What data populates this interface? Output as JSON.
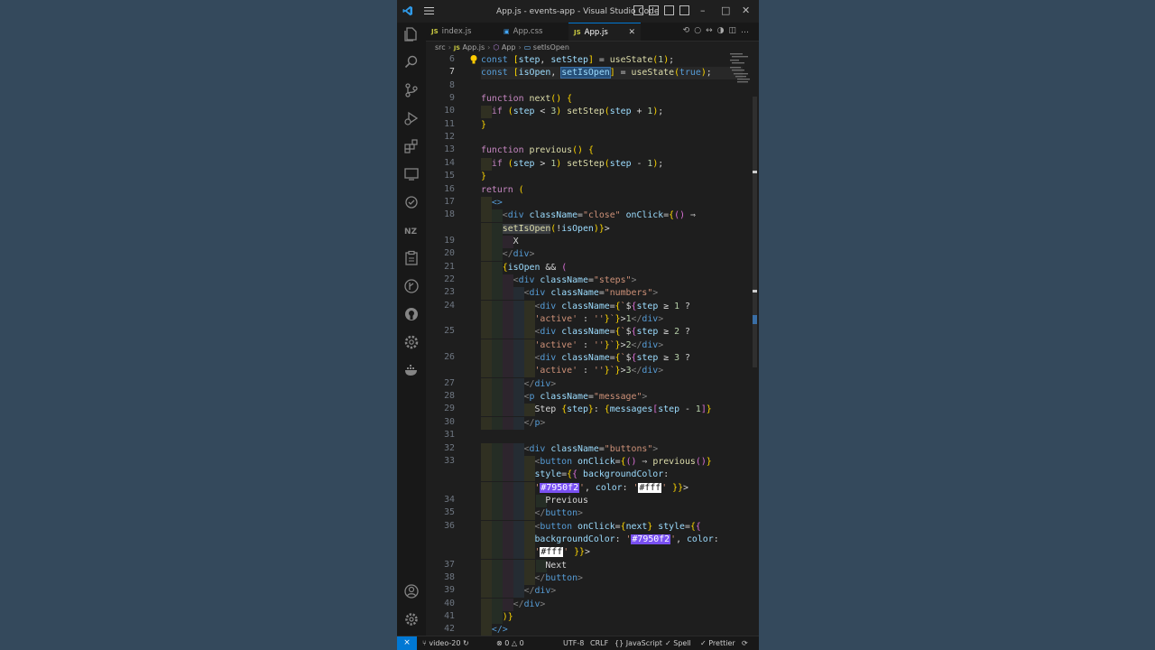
{
  "window": {
    "title": "App.js - events-app - Visual Studio Code",
    "brand_color": "#0078d4"
  },
  "tabs": [
    {
      "icon": "JS",
      "label": "index.js",
      "active": false
    },
    {
      "icon": "CSS",
      "label": "App.css",
      "active": false
    },
    {
      "icon": "JS",
      "label": "App.js",
      "active": true
    }
  ],
  "breadcrumb": {
    "folder": "src",
    "file": "App.js",
    "component": "App",
    "symbol": "setIsOpen"
  },
  "editor": {
    "current_line": "7",
    "lines": [
      {
        "n": "6",
        "t": "const [step, setStep] = useState(1);"
      },
      {
        "n": "7",
        "t": "const [isOpen, setIsOpen] = useState(true);"
      },
      {
        "n": "8",
        "t": ""
      },
      {
        "n": "9",
        "t": "function next() {"
      },
      {
        "n": "10",
        "t": "  if (step < 3) setStep(step + 1);"
      },
      {
        "n": "11",
        "t": "}"
      },
      {
        "n": "12",
        "t": ""
      },
      {
        "n": "13",
        "t": "function previous() {"
      },
      {
        "n": "14",
        "t": "  if (step > 1) setStep(step - 1);"
      },
      {
        "n": "15",
        "t": "}"
      },
      {
        "n": "16",
        "t": "return ("
      },
      {
        "n": "17",
        "t": "  <>"
      },
      {
        "n": "18",
        "t": "    <div className=\"close\" onClick={() ⇒"
      },
      {
        "n": "",
        "t": "    setIsOpen(!isOpen)}>"
      },
      {
        "n": "19",
        "t": "      X"
      },
      {
        "n": "20",
        "t": "    </div>"
      },
      {
        "n": "21",
        "t": "    {isOpen && ("
      },
      {
        "n": "22",
        "t": "      <div className=\"steps\">"
      },
      {
        "n": "23",
        "t": "        <div className=\"numbers\">"
      },
      {
        "n": "24",
        "t": "          <div className={`${step ≥ 1 ?"
      },
      {
        "n": "",
        "t": "          'active' : ''}`}>1</div>"
      },
      {
        "n": "25",
        "t": "          <div className={`${step ≥ 2 ?"
      },
      {
        "n": "",
        "t": "          'active' : ''}`}>2</div>"
      },
      {
        "n": "26",
        "t": "          <div className={`${step ≥ 3 ?"
      },
      {
        "n": "",
        "t": "          'active' : ''}`}>3</div>"
      },
      {
        "n": "27",
        "t": "        </div>"
      },
      {
        "n": "28",
        "t": "        <p className=\"message\">"
      },
      {
        "n": "29",
        "t": "          Step {step}: {messages[step - 1]}"
      },
      {
        "n": "30",
        "t": "        </p>"
      },
      {
        "n": "31",
        "t": ""
      },
      {
        "n": "32",
        "t": "        <div className=\"buttons\">"
      },
      {
        "n": "33",
        "t": "          <button onClick={() ⇒ previous()}"
      },
      {
        "n": "",
        "t": "          style={{ backgroundColor:"
      },
      {
        "n": "",
        "t": "          '#7950f2', color: '#fff' }}>"
      },
      {
        "n": "34",
        "t": "            Previous"
      },
      {
        "n": "35",
        "t": "          </button>"
      },
      {
        "n": "36",
        "t": "          <button onClick={next} style={{"
      },
      {
        "n": "",
        "t": "          backgroundColor: '#7950f2', color:"
      },
      {
        "n": "",
        "t": "          '#fff' }}>"
      },
      {
        "n": "37",
        "t": "            Next"
      },
      {
        "n": "38",
        "t": "          </button>"
      },
      {
        "n": "39",
        "t": "        </div>"
      },
      {
        "n": "40",
        "t": "      </div>"
      },
      {
        "n": "41",
        "t": "    )}"
      },
      {
        "n": "42",
        "t": "  </>"
      }
    ]
  },
  "statusbar": {
    "branch": "video-20",
    "errors": "0",
    "warnings": "0",
    "encoding": "UTF-8",
    "eol": "CRLF",
    "language": "JavaScript",
    "spell": "Spell",
    "formatter": "Prettier"
  }
}
